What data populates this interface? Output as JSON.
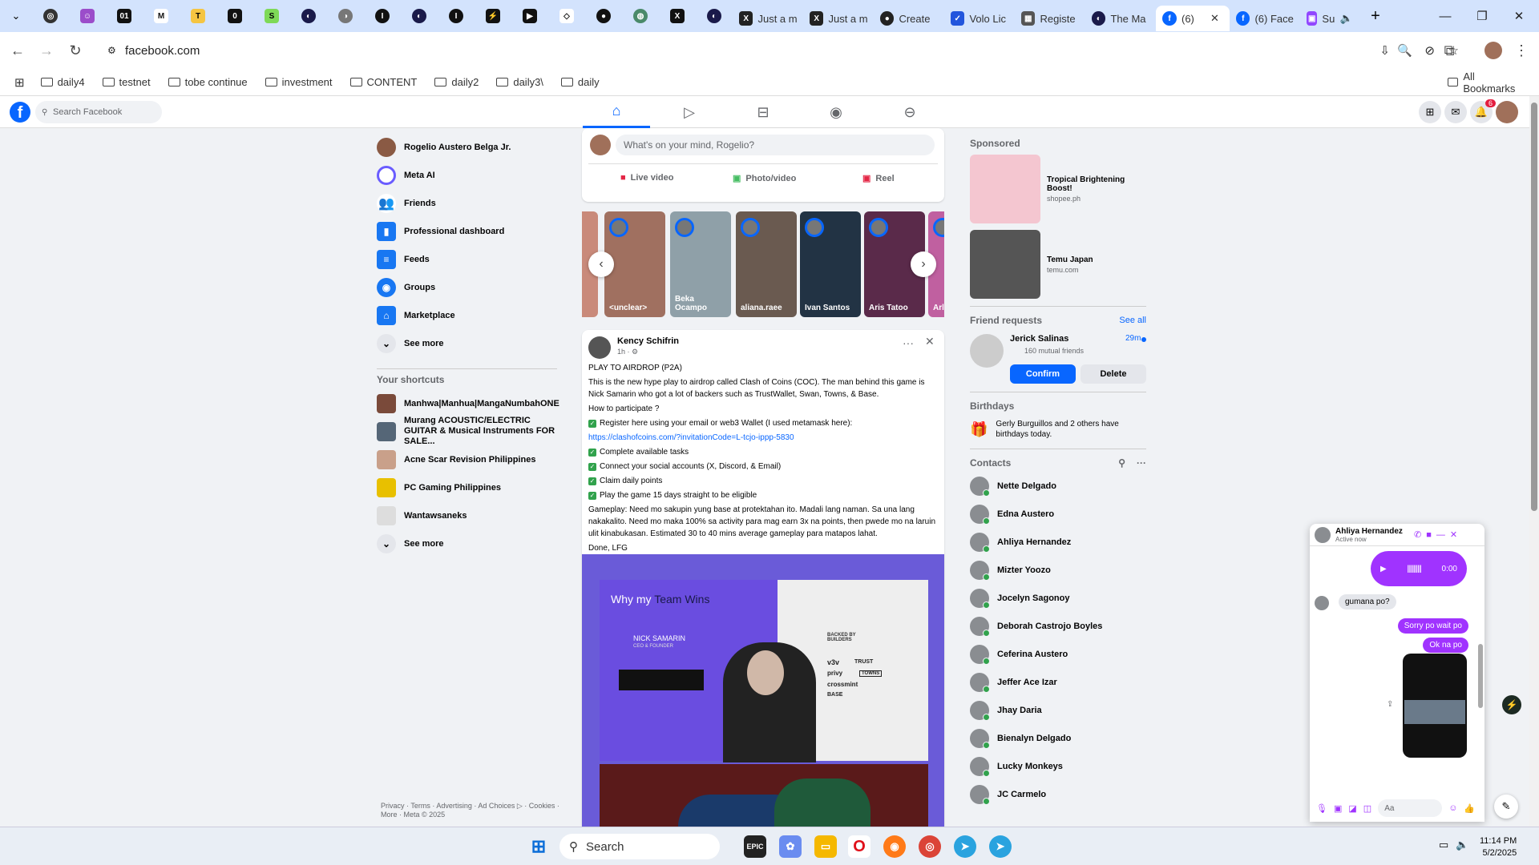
{
  "browser": {
    "tabs": [
      {
        "title": "Just a m",
        "icon": "x-icon"
      },
      {
        "title": "Just a m",
        "icon": "x-icon"
      },
      {
        "title": "Create",
        "icon": "circle-icon"
      },
      {
        "title": "Volo Lic",
        "icon": "check-icon"
      },
      {
        "title": "Registe",
        "icon": "page-icon"
      },
      {
        "title": "The Ma",
        "icon": "feather-icon"
      },
      {
        "title": "(6)",
        "icon": "facebook-icon",
        "active": true
      },
      {
        "title": "(6) Face",
        "icon": "facebook-icon"
      },
      {
        "title": "Sup",
        "icon": "twitch-icon"
      }
    ],
    "url": "facebook.com",
    "bookmarks": [
      "daily4",
      "testnet",
      "tobe continue",
      "investment",
      "CONTENT",
      "daily2",
      "daily3\\",
      "daily"
    ],
    "all_bookmarks": "All Bookmarks"
  },
  "fb": {
    "search_placeholder": "Search Facebook",
    "notif_count": "6"
  },
  "left": {
    "items": [
      {
        "label": "Rogelio Austero Belga Jr.",
        "icon": "avatar"
      },
      {
        "label": "Meta AI",
        "icon": "meta-ai-icon"
      },
      {
        "label": "Friends",
        "icon": "friends-icon"
      },
      {
        "label": "Professional dashboard",
        "icon": "dashboard-icon"
      },
      {
        "label": "Feeds",
        "icon": "feeds-icon"
      },
      {
        "label": "Groups",
        "icon": "groups-icon"
      },
      {
        "label": "Marketplace",
        "icon": "marketplace-icon"
      },
      {
        "label": "See more",
        "icon": "chevron-down-icon"
      }
    ],
    "shortcuts_title": "Your shortcuts",
    "shortcuts": [
      "Manhwa|Manhua|MangaNumbahONE",
      "Murang ACOUSTIC/ELECTRIC GUITAR & Musical Instruments FOR SALE...",
      "Acne Scar Revision Philippines",
      "PC Gaming Philippines",
      "Wantawsaneks",
      "See more"
    ],
    "footer": "Privacy · Terms · Advertising · Ad Choices ▷ · Cookies · More · Meta © 2025"
  },
  "composer": {
    "placeholder": "What's on your mind, Rogelio?",
    "live": "Live video",
    "photo": "Photo/video",
    "reel": "Reel"
  },
  "stories": [
    "<unclear>",
    "Beka Ocampo",
    "aliana.raee",
    "Ivan Santos",
    "Aris Tatoo",
    "Arle"
  ],
  "post": {
    "author": "Kency Schifrin",
    "time": "1h · ⚙",
    "title": "PLAY TO AIRDROP (P2A)",
    "intro": "This is the new hype play to airdrop called Clash of Coins (COC). The man behind this game is Nick Samarin who got a lot of backers such as TrustWallet, Swan, Towns, & Base.",
    "how": "How to participate ?",
    "step1": "Register here using your email or web3 Wallet (I used metamask here):",
    "link": "https://clashofcoins.com/?invitationCode=L-tcjo-ippp-5830",
    "step2": "Complete available tasks",
    "step3": "Connect your social accounts (X, Discord, & Email)",
    "step4": "Claim daily points",
    "step5": "Play the game 15 days straight to be eligible",
    "gameplay": "Gameplay: Need mo sakupin yung base at protektahan ito. Madali lang naman. Sa una lang nakakalito. Need mo maka 100% sa activity para mag earn 3x na points, then pwede mo na laruin ulit kinabukasan. Estimated 30 to 40 mins average gameplay para matapos lahat.",
    "done": "Done, LFG",
    "image": {
      "headline_a": "Why my ",
      "headline_b": "Team Wins",
      "name": "NICK SAMARIN",
      "role": "CEO & FOUNDER",
      "backed": "BACKED BY BUILDERS",
      "backers": [
        "v3v",
        "TRUST",
        "privy",
        "TOWNS",
        "crossmint",
        "BASE"
      ]
    }
  },
  "right": {
    "sponsored": "Sponsored",
    "ads": [
      {
        "title": "Tropical Brightening Boost!",
        "site": "shopee.ph"
      },
      {
        "title": "Temu Japan",
        "site": "temu.com"
      }
    ],
    "friend_requests": "Friend requests",
    "see_all": "See all",
    "requester": "Jerick Salinas",
    "req_time": "29m",
    "mutual": "160 mutual friends",
    "confirm": "Confirm",
    "delete": "Delete",
    "birthdays": "Birthdays",
    "birthday_text": "Gerly Burguillos and 2 others have birthdays today.",
    "contacts_title": "Contacts",
    "contacts": [
      "Nette Delgado",
      "Edna Austero",
      "Ahliya Hernandez",
      "Mizter Yoozo",
      "Jocelyn Sagonoy",
      "Deborah Castrojo Boyles",
      "Ceferina Austero",
      "Jeffer Ace Izar",
      "Jhay Daria",
      "Bienalyn Delgado",
      "Lucky Monkeys",
      "JC Carmelo"
    ]
  },
  "chat": {
    "name": "Ahliya Hernandez",
    "status": "Active now",
    "voice_time": "0:00",
    "msg1": "gumana po?",
    "msg2": "Sorry po wait po",
    "msg3": "Ok na po",
    "input_placeholder": "Aa"
  },
  "taskbar": {
    "search": "Search",
    "time": "11:14 PM",
    "date": "5/2/2025"
  }
}
